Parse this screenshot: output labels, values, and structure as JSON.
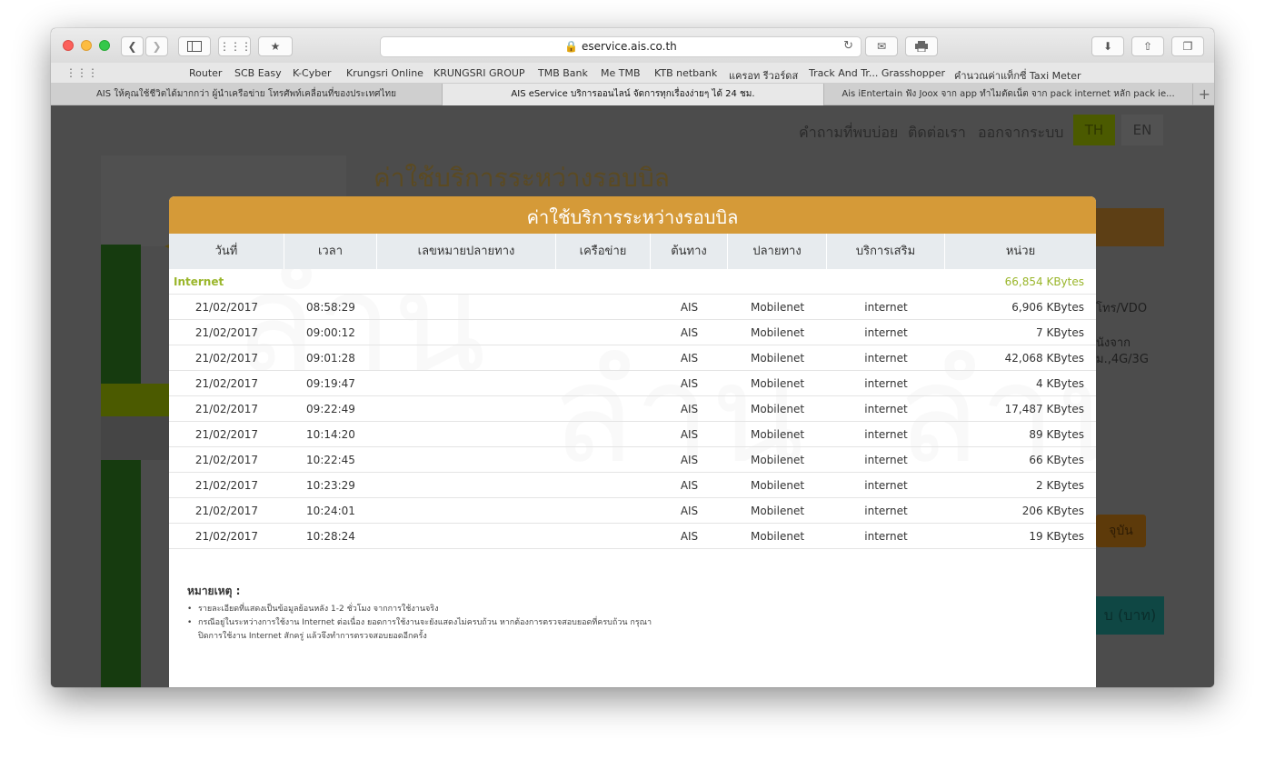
{
  "browser": {
    "url": "eservice.ais.co.th",
    "favorites": [
      "Router",
      "SCB Easy",
      "K-Cyber",
      "Krungsri Online",
      "KRUNGSRI GROUP",
      "TMB Bank",
      "Me TMB",
      "KTB netbank",
      "แครอท รีวอร์ดส",
      "Track And Tr... Grasshopper",
      "คำนวณค่าแท็กซี่ Taxi Meter"
    ],
    "tabs": [
      {
        "label": "AIS ให้คุณใช้ชีวิตได้มากกว่า ผู้นำเครือข่าย โทรศัพท์เคลื่อนที่ของประเทศไทย",
        "active": false
      },
      {
        "label": "AIS eService บริการออนไลน์ จัดการทุกเรื่องง่ายๆ ได้ 24 ชม.",
        "active": true
      },
      {
        "label": "Ais iEntertain ฟัง Joox จาก app ทำไมตัดเน็ต จาก pack internet หลัก pack ie...",
        "active": false
      }
    ]
  },
  "background": {
    "top_links": [
      "คำถามที่พบบ่อย",
      "ติดต่อเรา",
      "ออกจากระบบ"
    ],
    "lang_th": "TH",
    "lang_en": "EN",
    "page_title": "ค่าใช้บริการระหว่างรอบบิล",
    "right_texts": [
      "โทร/VDO",
      "นังจาก",
      "ม.,4G/3G"
    ],
    "right_button": "จุบัน",
    "right_teal": "บ (บาท)"
  },
  "modal": {
    "title": "ค่าใช้บริการระหว่างรอบบิล",
    "columns": [
      "วันที่",
      "เวลา",
      "เลขหมายปลายทาง",
      "เครือข่าย",
      "ต้นทาง",
      "ปลายทาง",
      "บริการเสริม",
      "หน่วย"
    ],
    "group_label": "Internet",
    "group_total": "66,854 KBytes",
    "rows": [
      {
        "date": "21/02/2017",
        "time": "08:58:29",
        "number": "",
        "network": "",
        "origin": "AIS",
        "dest": "Mobilenet",
        "service": "internet",
        "unit": "6,906 KBytes"
      },
      {
        "date": "21/02/2017",
        "time": "09:00:12",
        "number": "",
        "network": "",
        "origin": "AIS",
        "dest": "Mobilenet",
        "service": "internet",
        "unit": "7 KBytes"
      },
      {
        "date": "21/02/2017",
        "time": "09:01:28",
        "number": "",
        "network": "",
        "origin": "AIS",
        "dest": "Mobilenet",
        "service": "internet",
        "unit": "42,068 KBytes"
      },
      {
        "date": "21/02/2017",
        "time": "09:19:47",
        "number": "",
        "network": "",
        "origin": "AIS",
        "dest": "Mobilenet",
        "service": "internet",
        "unit": "4 KBytes"
      },
      {
        "date": "21/02/2017",
        "time": "09:22:49",
        "number": "",
        "network": "",
        "origin": "AIS",
        "dest": "Mobilenet",
        "service": "internet",
        "unit": "17,487 KBytes"
      },
      {
        "date": "21/02/2017",
        "time": "10:14:20",
        "number": "",
        "network": "",
        "origin": "AIS",
        "dest": "Mobilenet",
        "service": "internet",
        "unit": "89 KBytes"
      },
      {
        "date": "21/02/2017",
        "time": "10:22:45",
        "number": "",
        "network": "",
        "origin": "AIS",
        "dest": "Mobilenet",
        "service": "internet",
        "unit": "66 KBytes"
      },
      {
        "date": "21/02/2017",
        "time": "10:23:29",
        "number": "",
        "network": "",
        "origin": "AIS",
        "dest": "Mobilenet",
        "service": "internet",
        "unit": "2 KBytes"
      },
      {
        "date": "21/02/2017",
        "time": "10:24:01",
        "number": "",
        "network": "",
        "origin": "AIS",
        "dest": "Mobilenet",
        "service": "internet",
        "unit": "206 KBytes"
      },
      {
        "date": "21/02/2017",
        "time": "10:28:24",
        "number": "",
        "network": "",
        "origin": "AIS",
        "dest": "Mobilenet",
        "service": "internet",
        "unit": "19 KBytes"
      }
    ],
    "note_title": "หมายเหตุ :",
    "notes": [
      "รายละเอียดที่แสดงเป็นข้อมูลย้อนหลัง 1-2 ชั่วโมง จากการใช้งานจริง",
      "กรณีอยู่ในระหว่างการใช้งาน Internet ต่อเนื่อง ยอดการใช้งานจะยังแสดงไม่ครบถ้วน หากต้องการตรวจสอบยอดที่ครบถ้วน กรุณาปิดการใช้งาน Internet สักครู่ แล้วจึงทำการตรวจสอบยอดอีกครั้ง"
    ]
  }
}
